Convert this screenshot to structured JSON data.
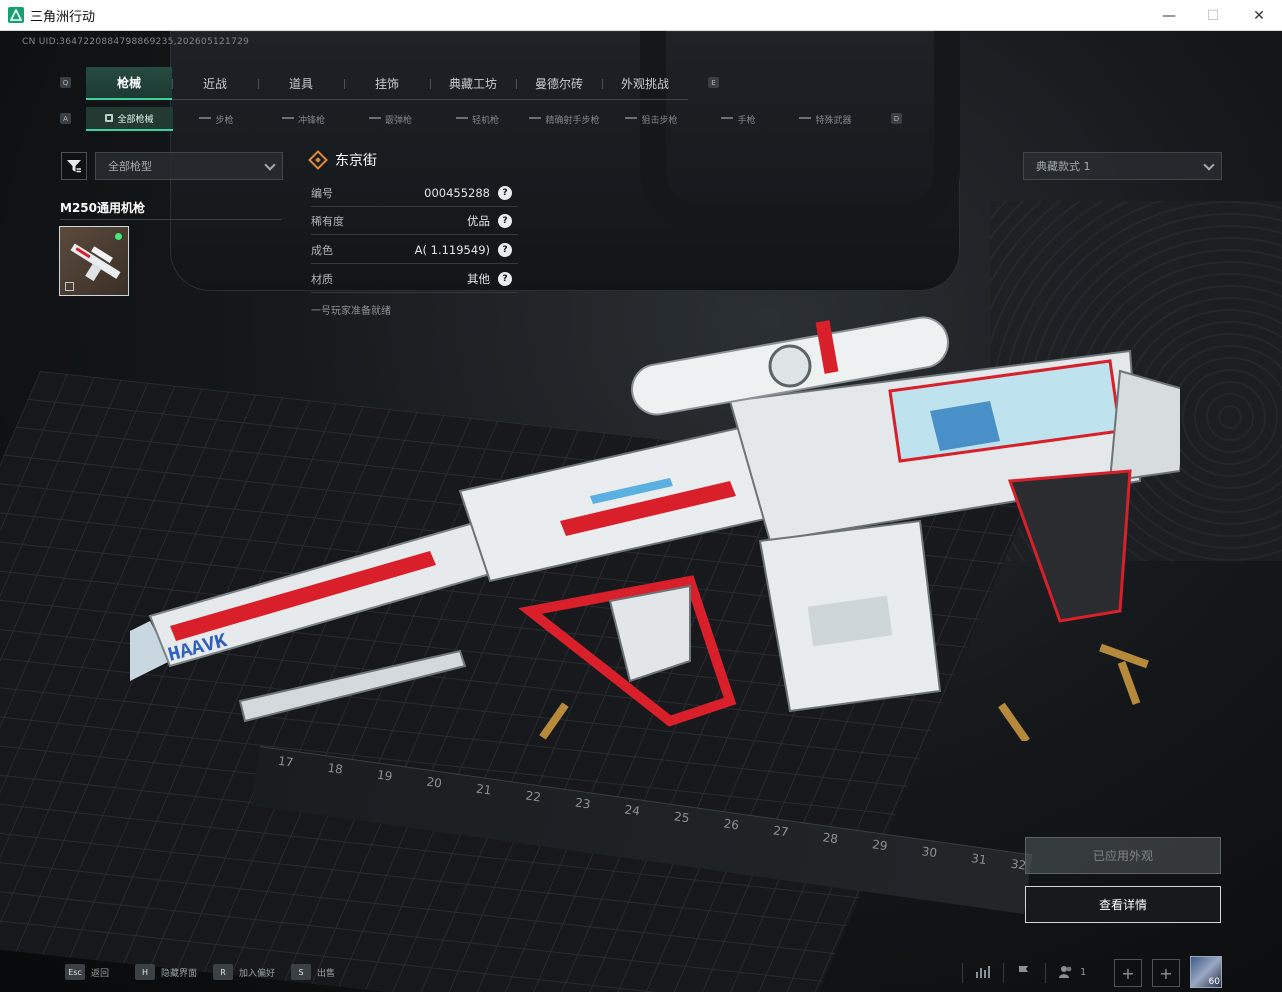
{
  "window": {
    "title": "三角洲行动",
    "controls": {
      "minimize": "—",
      "maximize": "☐",
      "close": "✕"
    }
  },
  "uid": "CN UID:3647220884798869235,202605121729",
  "tabs": [
    {
      "label": "枪械",
      "active": true
    },
    {
      "label": "近战",
      "active": false
    },
    {
      "label": "道具",
      "active": false
    },
    {
      "label": "挂饰",
      "active": false
    },
    {
      "label": "典藏工坊",
      "active": false
    },
    {
      "label": "曼德尔砖",
      "active": false
    },
    {
      "label": "外观挑战",
      "active": false
    }
  ],
  "tab_keys": {
    "prev": "Q",
    "next": "E"
  },
  "subtabs": [
    {
      "label": "全部枪械",
      "active": true
    },
    {
      "label": "步枪",
      "active": false
    },
    {
      "label": "冲锋枪",
      "active": false
    },
    {
      "label": "霰弹枪",
      "active": false
    },
    {
      "label": "轻机枪",
      "active": false
    },
    {
      "label": "精确射手步枪",
      "active": false
    },
    {
      "label": "狙击步枪",
      "active": false
    },
    {
      "label": "手枪",
      "active": false
    },
    {
      "label": "特殊武器",
      "active": false
    }
  ],
  "subtab_keys": {
    "prev": "A",
    "next": "D"
  },
  "filter": {
    "selected": "全部枪型"
  },
  "weapon": {
    "name": "M250通用机枪"
  },
  "skin": {
    "name": "东京街",
    "properties": [
      {
        "label": "编号",
        "value": "000455288"
      },
      {
        "label": "稀有度",
        "value": "优品"
      },
      {
        "label": "成色",
        "value": "A( 1.119549)"
      },
      {
        "label": "材质",
        "value": "其他"
      }
    ],
    "help_glyph": "?",
    "description": "一号玩家准备就绪"
  },
  "style_select": {
    "selected": "典藏款式 1"
  },
  "gun_marking": "HAAVK",
  "buttons": {
    "applied": "已应用外观",
    "details": "查看详情"
  },
  "bottom_hints": [
    {
      "key": "Esc",
      "label": "返回"
    },
    {
      "key": "H",
      "label": "隐藏界面"
    },
    {
      "key": "R",
      "label": "加入偏好"
    },
    {
      "key": "S",
      "label": "出售"
    }
  ],
  "social": {
    "friends_count": "1",
    "avatar_level": "60"
  },
  "ruler_numbers": [
    "17",
    "18",
    "19",
    "20",
    "21",
    "22",
    "23",
    "24",
    "25",
    "26",
    "27",
    "28",
    "29",
    "30",
    "31",
    "32"
  ],
  "colors": {
    "accent": "#38d39f",
    "gun_red": "#d9202a",
    "gun_white": "#e8ecee",
    "gun_ice": "#bfe3ee"
  }
}
